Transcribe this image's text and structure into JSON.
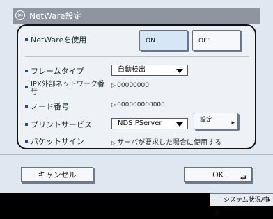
{
  "title": "NetWare設定",
  "netware": {
    "label": "NetWareを使用",
    "on": "ON",
    "off": "OFF"
  },
  "frame_type": {
    "label": "フレームタイプ",
    "value": "自動検出"
  },
  "ipx": {
    "label": "IPX外部ネットワーク番号",
    "value": "00000000"
  },
  "node": {
    "label": "ノード番号",
    "value": "000000000000"
  },
  "print_service": {
    "label": "プリントサービス",
    "value": "NDS PServer",
    "setting": "設定"
  },
  "packet_sign": {
    "label": "パケットサイン",
    "value": "サーバが要求した場合に使用する"
  },
  "footer": {
    "cancel": "キャンセル",
    "ok": "OK"
  },
  "status": {
    "label": "システム状況/中止"
  }
}
